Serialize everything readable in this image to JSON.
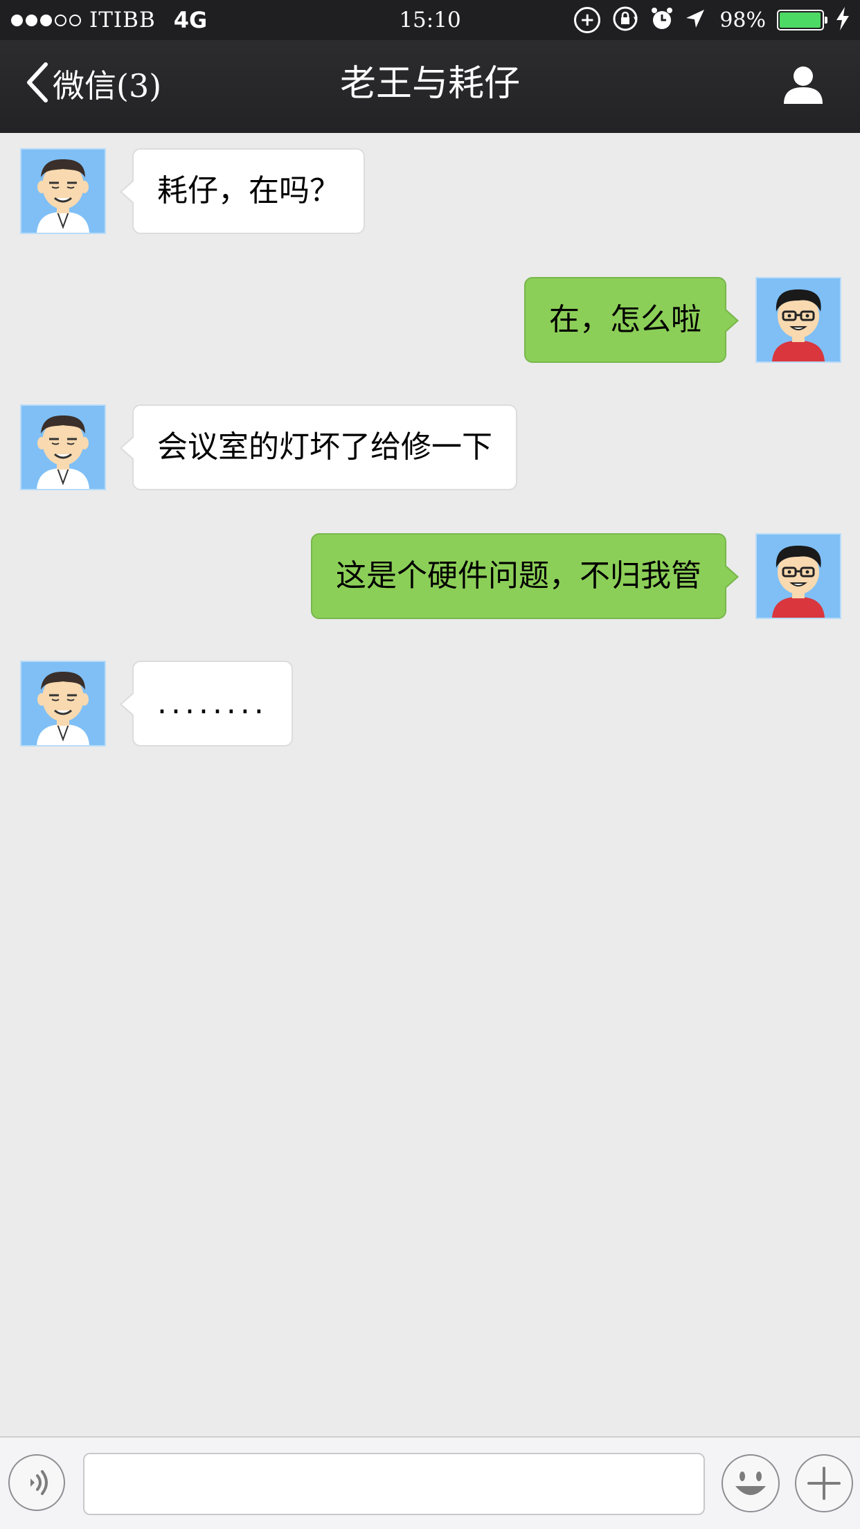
{
  "status_bar": {
    "signal_filled": 3,
    "signal_total": 5,
    "carrier": "ITIBB",
    "network": "4G",
    "time": "15:10",
    "icons": [
      "vpn-plus-icon",
      "rotation-lock-icon",
      "alarm-icon",
      "location-arrow-icon"
    ],
    "battery_percent": "98%",
    "battery_level": 0.98,
    "battery_color": "#4cd964"
  },
  "nav": {
    "back_label": "微信(3)",
    "title": "老王与耗仔",
    "profile_icon": "person-icon"
  },
  "messages": [
    {
      "direction": "in",
      "sender": "laowang",
      "text": "耗仔，在吗？"
    },
    {
      "direction": "out",
      "sender": "haozai",
      "text": "在，怎么啦"
    },
    {
      "direction": "in",
      "sender": "laowang",
      "text": "会议室的灯坏了给修一下"
    },
    {
      "direction": "out",
      "sender": "haozai",
      "text": "这是个硬件问题，不归我管"
    },
    {
      "direction": "in",
      "sender": "laowang",
      "text": "........"
    }
  ],
  "input_bar": {
    "voice_icon": "voice-icon",
    "input_value": "",
    "emoji_icon": "emoji-icon",
    "plus_icon": "plus-icon"
  },
  "colors": {
    "bar_dark": "#1f1f21",
    "chat_bg": "#ebebeb",
    "bubble_out": "#8ccf58",
    "bubble_in": "#ffffff",
    "avatar_bg": "#7fbff5"
  }
}
